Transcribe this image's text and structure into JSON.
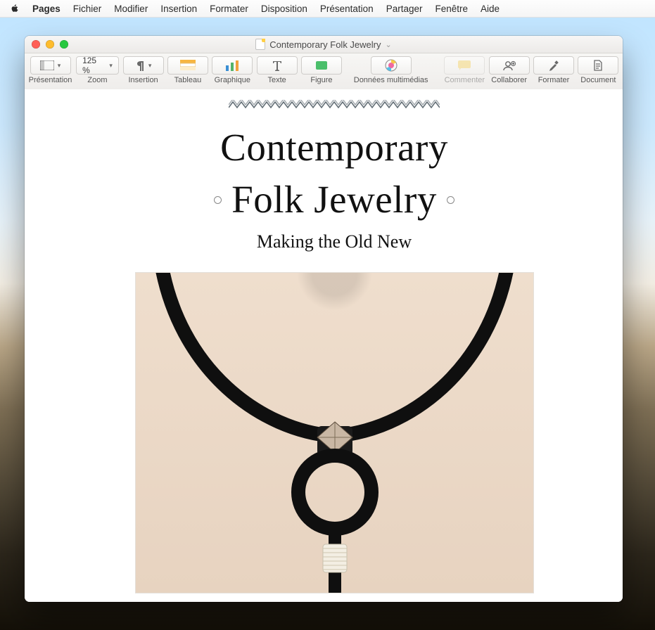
{
  "menubar": {
    "app": "Pages",
    "items": [
      "Fichier",
      "Modifier",
      "Insertion",
      "Formater",
      "Disposition",
      "Présentation",
      "Partager",
      "Fenêtre",
      "Aide"
    ]
  },
  "window": {
    "title": "Contemporary Folk Jewelry"
  },
  "toolbar": {
    "presentation": "Présentation",
    "zoom_label": "Zoom",
    "zoom_value": "125 %",
    "insertion": "Insertion",
    "tableau": "Tableau",
    "graphique": "Graphique",
    "texte": "Texte",
    "figure": "Figure",
    "medias": "Données multimédias",
    "commenter": "Commenter",
    "collaborer": "Collaborer",
    "formater": "Formater",
    "document": "Document"
  },
  "document": {
    "title_line1": "Contemporary",
    "title_line2": "Folk Jewelry",
    "subtitle": "Making the Old New"
  }
}
